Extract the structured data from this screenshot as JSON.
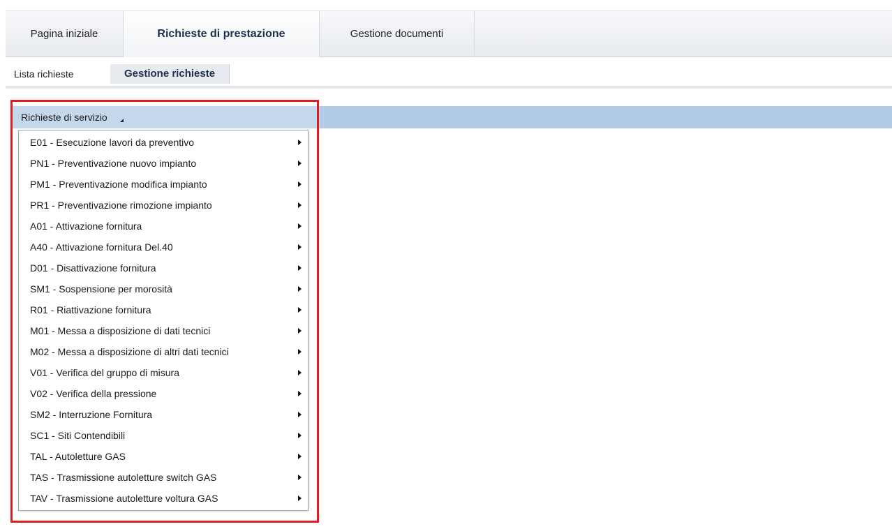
{
  "top_tabs": [
    {
      "label": "Pagina iniziale",
      "active": false
    },
    {
      "label": "Richieste di prestazione",
      "active": true
    },
    {
      "label": "Gestione documenti",
      "active": false
    }
  ],
  "sub_tabs": [
    {
      "label": "Lista richieste",
      "active": false
    },
    {
      "label": "Gestione richieste",
      "active": true
    }
  ],
  "menu": {
    "trigger_label": "Richieste di servizio",
    "items": [
      {
        "label": "E01 - Esecuzione lavori da preventivo"
      },
      {
        "label": "PN1 - Preventivazione nuovo impianto"
      },
      {
        "label": "PM1 - Preventivazione modifica impianto"
      },
      {
        "label": "PR1 - Preventivazione rimozione impianto"
      },
      {
        "label": "A01 - Attivazione fornitura"
      },
      {
        "label": "A40 - Attivazione fornitura Del.40"
      },
      {
        "label": "D01 - Disattivazione fornitura"
      },
      {
        "label": "SM1 - Sospensione per morosità"
      },
      {
        "label": "R01 - Riattivazione fornitura"
      },
      {
        "label": "M01 - Messa a disposizione di dati tecnici"
      },
      {
        "label": "M02 - Messa a disposizione di altri dati tecnici"
      },
      {
        "label": "V01 - Verifica del gruppo di misura"
      },
      {
        "label": "V02 - Verifica della pressione"
      },
      {
        "label": "SM2 - Interruzione Fornitura"
      },
      {
        "label": "SC1 - Siti Contendibili"
      },
      {
        "label": "TAL - Autoletture GAS"
      },
      {
        "label": "TAS - Trasmissione autoletture switch GAS"
      },
      {
        "label": "TAV - Trasmissione autoletture voltura GAS"
      }
    ]
  },
  "colors": {
    "menu_bar": "#b3cce6",
    "highlight_border": "#e11d24"
  },
  "icons": {
    "menu_caret": "caret-down-icon",
    "submenu_arrow": "chevron-right-icon"
  }
}
